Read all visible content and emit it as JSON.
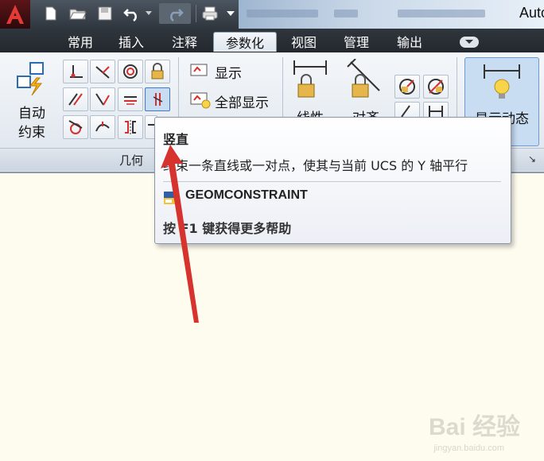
{
  "app": {
    "title_partial": "Auto"
  },
  "ribbon_tabs": [
    {
      "label": "常用"
    },
    {
      "label": "插入"
    },
    {
      "label": "注释"
    },
    {
      "label": "参数化",
      "active": true
    },
    {
      "label": "视图"
    },
    {
      "label": "管理"
    },
    {
      "label": "输出"
    }
  ],
  "geometry_panel": {
    "auto_constrain_label": "自动\n约束",
    "auto_constrain_line1": "自动",
    "auto_constrain_line2": "约束",
    "title": "几何",
    "buttons": [
      "coincident",
      "perpendicular",
      "concentric",
      "fix",
      "parallel",
      "tangent-angle",
      "horizontal",
      "vertical",
      "tangent",
      "smooth",
      "symmetric",
      "equal"
    ],
    "selected_button": "vertical"
  },
  "display_panel": {
    "show_label": "显示",
    "show_all_label": "全部显示"
  },
  "dimension_panel": {
    "linear_label": "线性",
    "aligned_label": "对齐",
    "show_dynamic_label": "显示动态"
  },
  "tooltip": {
    "title": "竖直",
    "description": "约束一条直线或一对点，使其与当前 UCS 的 Y 轴平行",
    "command": "GEOMCONSTRAINT",
    "help": "按 F1 键获得更多帮助"
  },
  "watermark": {
    "brand": "Bai 经验",
    "url": "jingyan.baidu.com"
  },
  "colors": {
    "accent": "#d7332e",
    "ribbon": "#e4eaf1",
    "canvas": "#fefbef"
  }
}
